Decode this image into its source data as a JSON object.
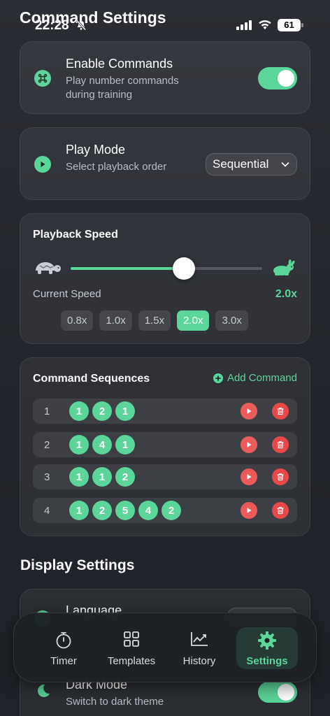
{
  "status": {
    "time": "22:28",
    "battery": "61"
  },
  "header": {
    "title": "Command Settings"
  },
  "enable_commands": {
    "title": "Enable Commands",
    "subtitle": "Play number commands during training",
    "enabled": true
  },
  "play_mode": {
    "title": "Play Mode",
    "subtitle": "Select playback order",
    "selected": "Sequential"
  },
  "playback_speed": {
    "title": "Playback Speed",
    "current_label": "Current Speed",
    "current_value": "2.0x",
    "slider_fraction": 0.59,
    "options": [
      "0.8x",
      "1.0x",
      "1.5x",
      "2.0x",
      "3.0x"
    ],
    "active_option": "2.0x"
  },
  "command_sequences": {
    "title": "Command Sequences",
    "add_label": "Add Command",
    "rows": [
      {
        "index": "1",
        "numbers": [
          "1",
          "2",
          "1"
        ]
      },
      {
        "index": "2",
        "numbers": [
          "1",
          "4",
          "1"
        ]
      },
      {
        "index": "3",
        "numbers": [
          "1",
          "1",
          "2"
        ]
      },
      {
        "index": "4",
        "numbers": [
          "1",
          "2",
          "5",
          "4",
          "2"
        ]
      }
    ]
  },
  "display_settings": {
    "title": "Display Settings",
    "language_title": "Language",
    "dark_mode": {
      "title": "Dark Mode",
      "subtitle": "Switch to dark theme",
      "enabled": true
    }
  },
  "tabs": [
    {
      "label": "Timer",
      "icon": "stopwatch-icon",
      "active": false
    },
    {
      "label": "Templates",
      "icon": "grid-icon",
      "active": false
    },
    {
      "label": "History",
      "icon": "chart-icon",
      "active": false
    },
    {
      "label": "Settings",
      "icon": "gear-icon",
      "active": true
    }
  ],
  "colors": {
    "accent": "#5bd59a",
    "danger": "#e84848",
    "background": "#25282e"
  }
}
